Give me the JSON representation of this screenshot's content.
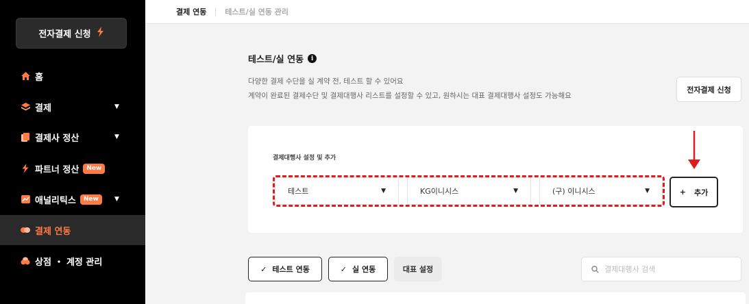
{
  "sidebar": {
    "apply_label": "전자결제 신청",
    "items": [
      {
        "label": "홈",
        "icon": "home-icon",
        "caret": false
      },
      {
        "label": "결제",
        "icon": "layers-icon",
        "caret": true
      },
      {
        "label": "결제사 정산",
        "icon": "document-icon",
        "caret": true
      },
      {
        "label": "파트너 정산",
        "icon": "bolt-icon",
        "caret": false,
        "badge": "New"
      },
      {
        "label": "애널리틱스",
        "icon": "chart-icon",
        "caret": true,
        "badge": "New"
      },
      {
        "label": "결제 연동",
        "icon": "link-icon",
        "caret": false,
        "active": true
      },
      {
        "label": "상점 ・ 계정 관리",
        "icon": "cloud-icon",
        "caret": false
      }
    ]
  },
  "topbar": {
    "tab_active": "결제 연동",
    "tab_inactive": "테스트/실 연동 관리"
  },
  "header": {
    "title": "테스트/실 연동",
    "desc1": "다양한 결제 수단을 실 계약 전, 테스트 할 수 있어요",
    "desc2": "계약이 완료된 결제수단 및 결제대행사 리스트를 설정할 수 있고, 원하시는 대표 결제대행사 설정도 가능해요",
    "apply_label": "전자결제 신청"
  },
  "pg_card": {
    "label": "결제대행사 설정 및 추가",
    "select_mode": "테스트",
    "select_pg": "KG이니시스",
    "select_module": "(구) 이니시스",
    "add_label": "추가",
    "add_icon": "+"
  },
  "filters": {
    "test_label": "테스트 연동",
    "real_label": "실 연동",
    "rep_label": "대표 설정",
    "search_placeholder": "결제대행사 검색"
  },
  "colors": {
    "accent": "#ff7a45",
    "highlight": "#e01b1b",
    "sidebar_bg": "#000000"
  }
}
